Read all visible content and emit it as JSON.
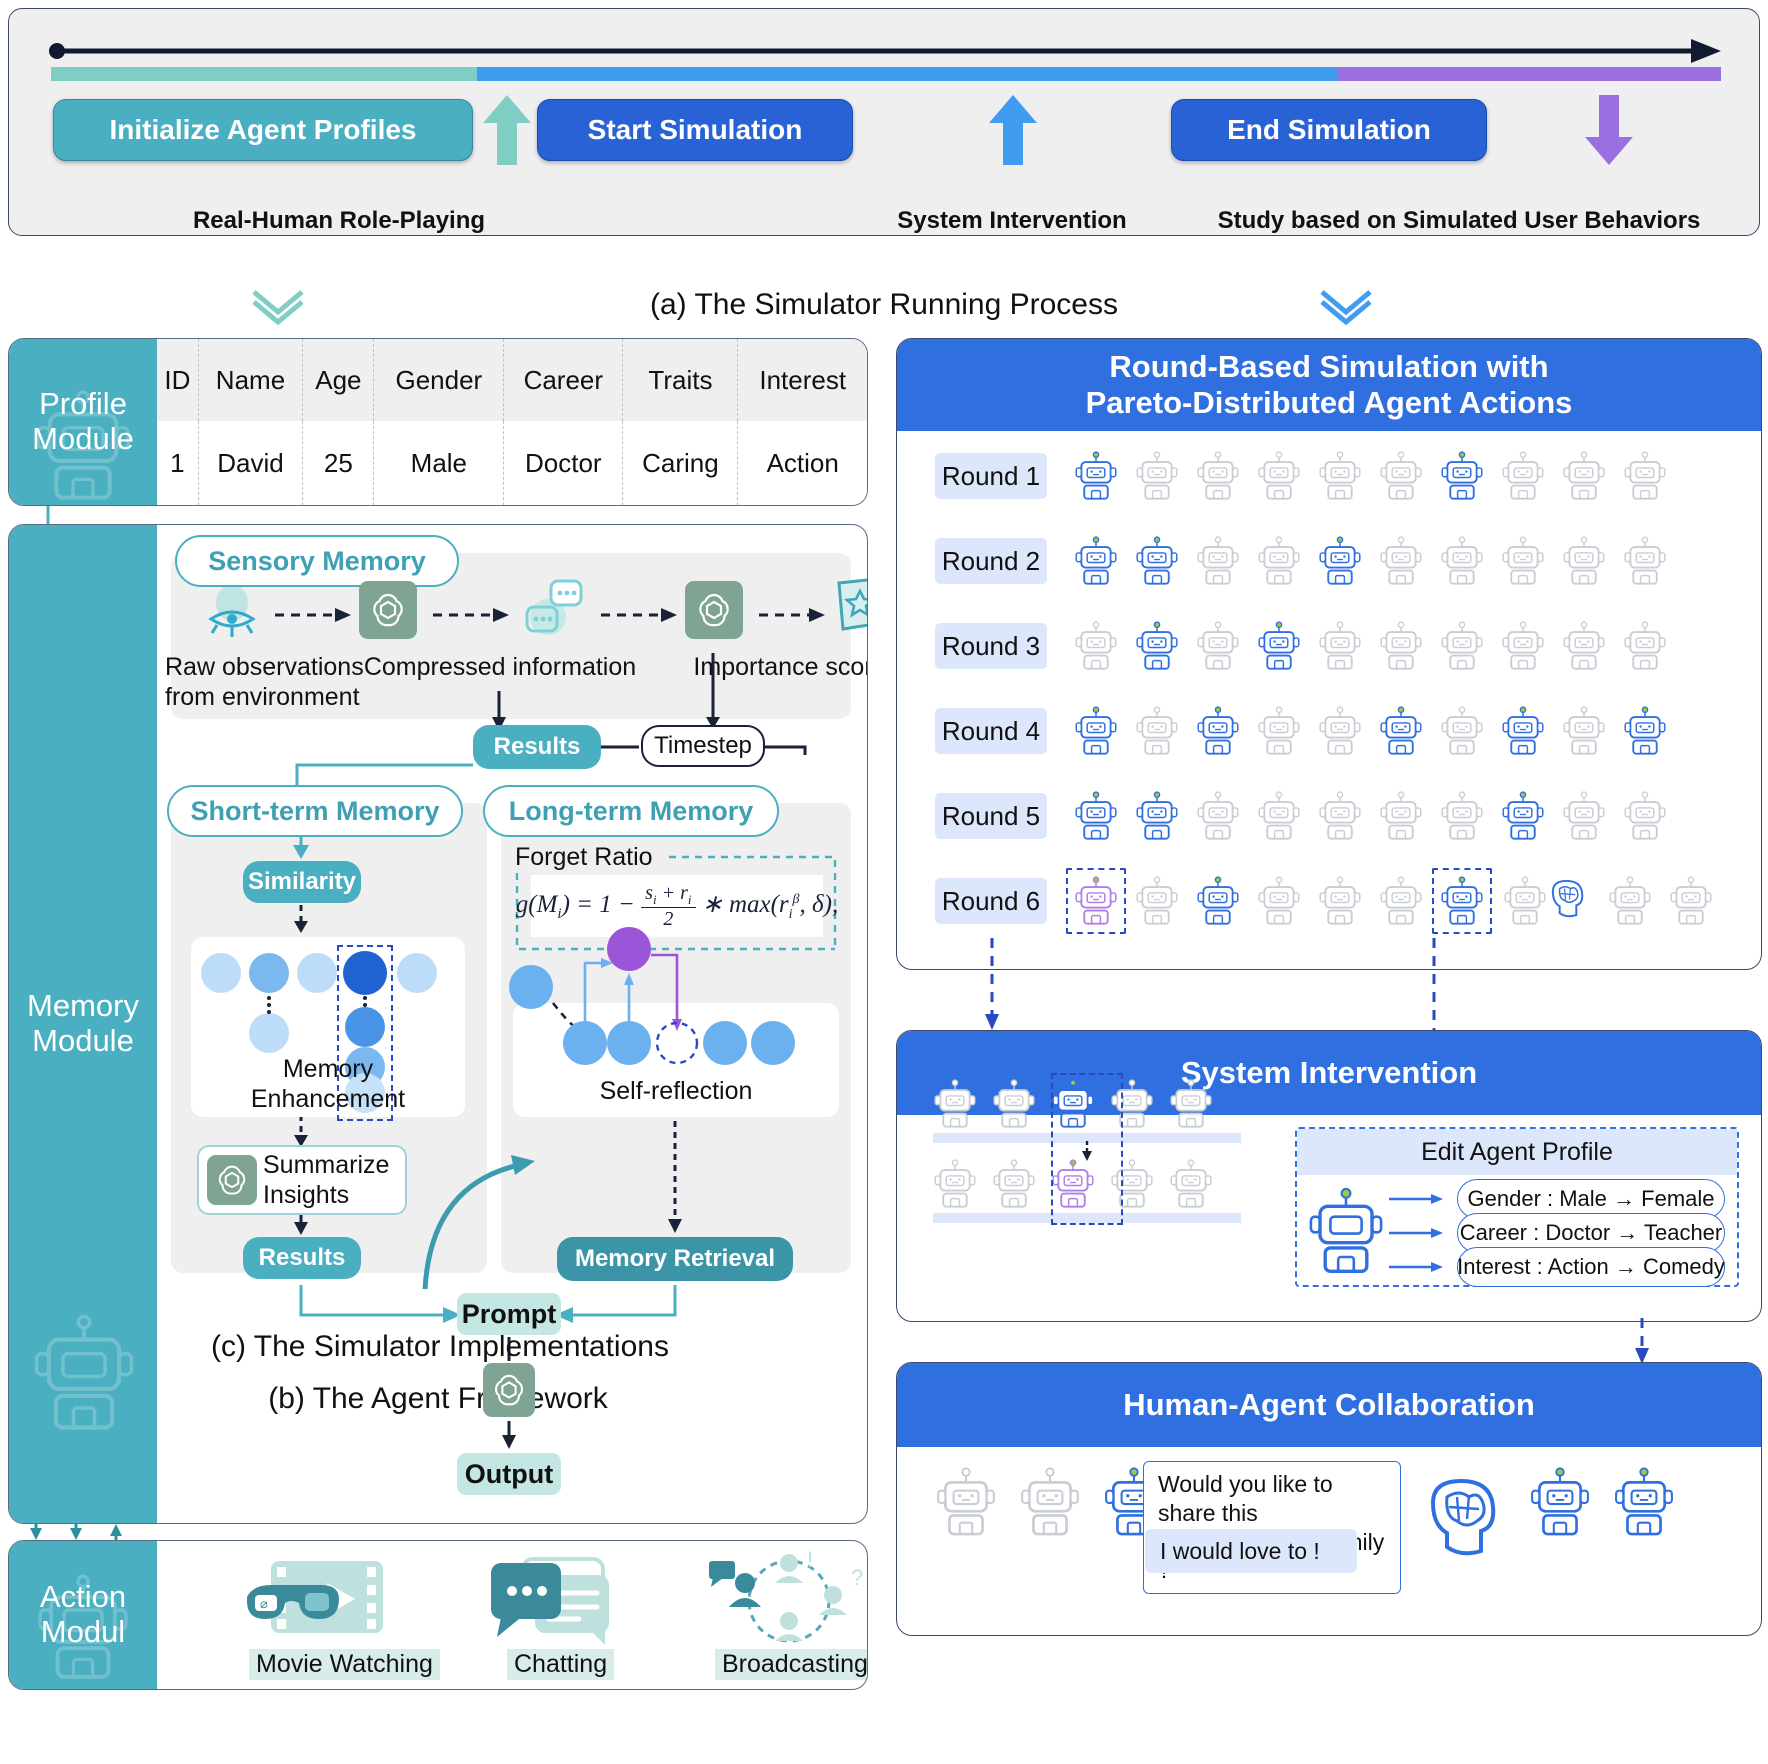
{
  "figure": {
    "caption_a": "(a) The Simulator Running Process",
    "caption_b": "(b) The Agent Framework",
    "caption_c": "(c) The Simulator Implementations"
  },
  "colors": {
    "teal": "#4aafc0",
    "mint": "#7ecec4",
    "blue": "#2862d4",
    "blue_light": "#3f9cf0",
    "purple": "#9a6fe0",
    "grey_panel": "#efefef",
    "header_blue": "#2f6fe0",
    "robot_active": "#2f6fe0",
    "robot_idle": "#c9cdd4",
    "robot_purple": "#b07ee8",
    "antenna_green": "#9ccb3b"
  },
  "process": {
    "pills": [
      {
        "label": "Initialize Agent Profiles",
        "color": "#4aafc0"
      },
      {
        "label": "Start Simulation",
        "color": "#2862d4"
      },
      {
        "label": "End Simulation",
        "color": "#2862d4"
      }
    ],
    "arrows": [
      {
        "name": "teal-up-arrow",
        "direction": "up",
        "color": "#7ecec4"
      },
      {
        "name": "blue-up-arrow",
        "direction": "up",
        "color": "#3f9cf0"
      },
      {
        "name": "purple-down-arrow",
        "direction": "down",
        "color": "#9a6fe0"
      }
    ],
    "captions": [
      "Real-Human Role-Playing",
      "System Intervention",
      "Study based on Simulated User Behaviors"
    ],
    "segments": [
      {
        "color": "#7ecec4",
        "width_pct": 25.5
      },
      {
        "color": "#3f9cf0",
        "width_pct": 51.5
      },
      {
        "color": "#9a6fe0",
        "width_pct": 23.0
      }
    ]
  },
  "framework": {
    "profile_module": {
      "title": "Profile\nModule",
      "title_line1": "Profile",
      "title_line2": "Module",
      "columns": [
        "ID",
        "Name",
        "Age",
        "Gender",
        "Career",
        "Traits",
        "Interest"
      ],
      "rows": [
        [
          "1",
          "David",
          "25",
          "Male",
          "Doctor",
          "Caring",
          "Action"
        ]
      ]
    },
    "memory_module": {
      "title_line1": "Memory",
      "title_line2": "Module",
      "sensory": {
        "title": "Sensory Memory",
        "icons": [
          "eye-icon",
          "gpt-icon",
          "chat-bubble-icon",
          "gpt-icon",
          "note-score-icon"
        ],
        "label_1": "Raw observations\nfrom environment",
        "label_1_line1": "Raw observations",
        "label_1_line2": "from environment",
        "label_2": "Compressed information",
        "label_3": "Importance score"
      },
      "results_top": "Results",
      "timestep": "Timestep",
      "short_term": {
        "title": "Short-term Memory",
        "similarity_chip": "Similarity",
        "enhancement_label_line1": "Memory",
        "enhancement_label_line2": "Enhancement",
        "summarize_line1": "Summarize",
        "summarize_line2": "Insights",
        "results_chip": "Results"
      },
      "long_term": {
        "title": "Long-term Memory",
        "forget_ratio_label": "Forget Ratio",
        "formula": "g(M_i) = 1 - (s_i + r_i)/2 * max(r_i^β, δ),",
        "formula_lhs": "g(M",
        "self_reflection_label": "Self-reflection",
        "memory_retrieval_chip": "Memory Retrieval"
      },
      "prompt_chip": "Prompt",
      "output_chip": "Output"
    },
    "action_module": {
      "title_line1": "Action",
      "title_line2": "Modul",
      "actions": [
        {
          "label": "Movie Watching",
          "icon": "movie-glasses-icon"
        },
        {
          "label": "Chatting",
          "icon": "chat-bubbles-icon"
        },
        {
          "label": "Broadcasting",
          "icon": "broadcast-network-icon"
        }
      ]
    }
  },
  "implementations": {
    "rounds_card": {
      "title_line1": "Round-Based Simulation with",
      "title_line2": "Pareto-Distributed Agent Actions",
      "rounds": [
        {
          "label": "Round 1",
          "active": [
            0,
            6
          ],
          "purple": [],
          "brain": [],
          "boxed": []
        },
        {
          "label": "Round 2",
          "active": [
            0,
            1,
            4
          ],
          "purple": [],
          "brain": [],
          "boxed": []
        },
        {
          "label": "Round 3",
          "active": [
            1,
            3
          ],
          "purple": [],
          "brain": [],
          "boxed": []
        },
        {
          "label": "Round 4",
          "active": [
            0,
            2,
            5,
            7,
            9
          ],
          "purple": [],
          "brain": [],
          "boxed": []
        },
        {
          "label": "Round 5",
          "active": [
            0,
            1,
            7
          ],
          "purple": [],
          "brain": [],
          "boxed": []
        },
        {
          "label": "Round 6",
          "active": [
            2,
            6
          ],
          "purple": [
            0
          ],
          "brain": [
            7
          ],
          "boxed": [
            0,
            6
          ]
        }
      ],
      "agents_per_round": 10
    },
    "system_intervention": {
      "title": "System Intervention",
      "edit_panel_title": "Edit Agent Profile",
      "edits": [
        "Gender : Male → Female",
        "Career : Doctor → Teacher",
        "Interest : Action → Comedy"
      ]
    },
    "human_agent_collaboration": {
      "title": "Human-Agent Collaboration",
      "question": "Would you like to share this\nmovie with your family ?",
      "question_line1": "Would you like to share this",
      "question_line2": "movie with your family ?",
      "answer": "I would love to !"
    }
  }
}
